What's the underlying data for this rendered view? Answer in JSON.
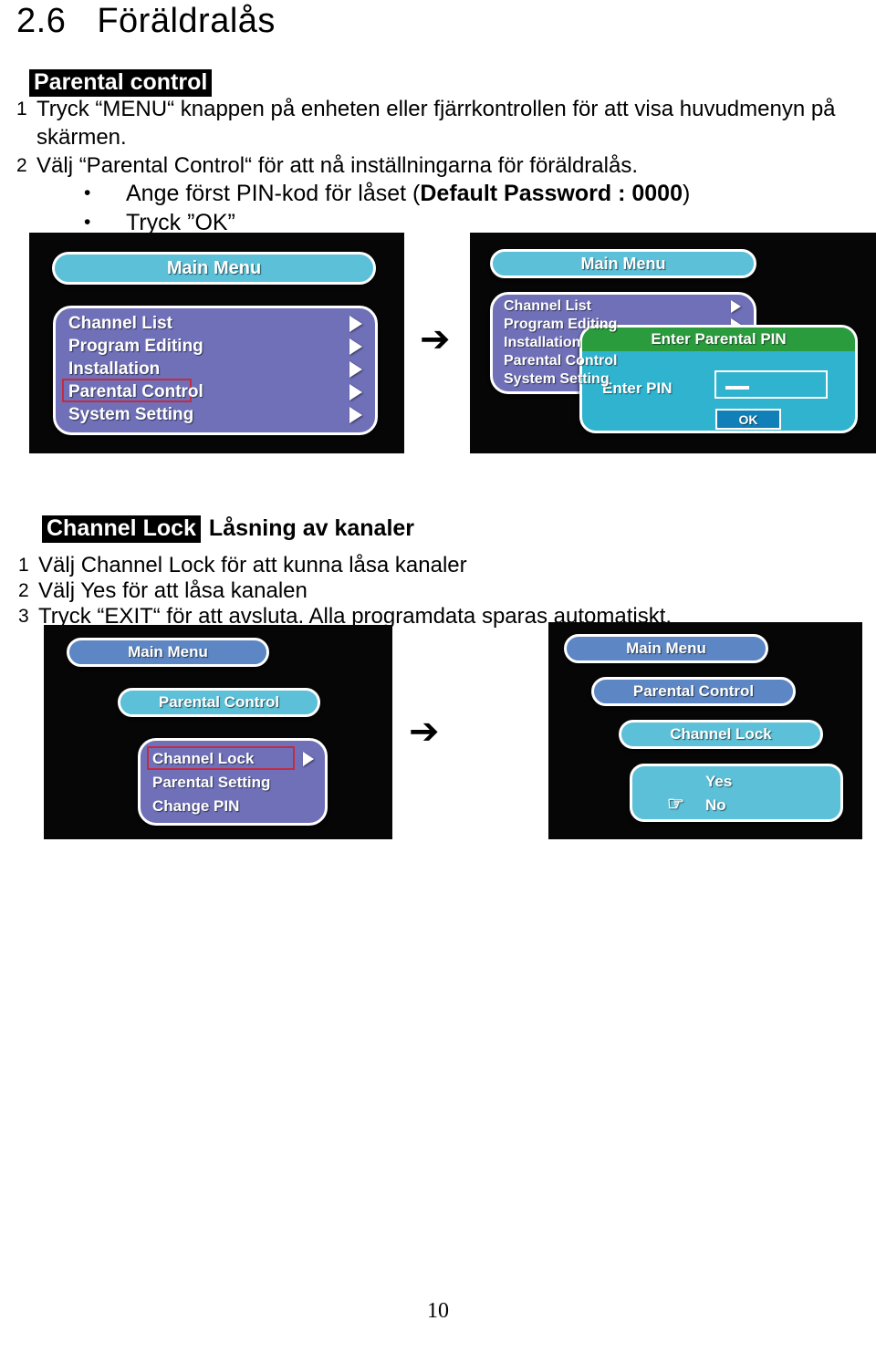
{
  "heading": {
    "number": "2.6",
    "title": "Föräldralås"
  },
  "section1": {
    "black_header": "Parental control",
    "steps": [
      {
        "index": "1",
        "text": "Tryck “MENU“ knappen på enheten eller fjärrkontrollen för att visa huvudmenyn på skärmen."
      },
      {
        "index": "2",
        "text": "Välj “Parental Control“ för att nå inställningarna för föräldralås."
      }
    ],
    "bullets": [
      {
        "marker": "•",
        "text_before": "Ange först PIN-kod för låset (",
        "text_bold": "Default Password : 0000",
        "text_after": ")"
      },
      {
        "marker": "•",
        "text_before": "Tryck ”OK”",
        "text_bold": "",
        "text_after": ""
      }
    ]
  },
  "section2": {
    "black_header": "Channel Lock",
    "header_suffix": "Låsning av kanaler",
    "steps": [
      {
        "index": "1",
        "text": "Välj Channel Lock för att kunna låsa kanaler"
      },
      {
        "index": "2",
        "text": "Välj Yes för att låsa kanalen"
      },
      {
        "index": "3",
        "text": "Tryck “EXIT“ för att avsluta. Alla programdata sparas automatiskt."
      }
    ]
  },
  "flow_arrow": "➔",
  "screens": {
    "top_left": {
      "title_bar": "Main Menu",
      "items": [
        {
          "label": "Channel List",
          "arrow": true,
          "selected": false
        },
        {
          "label": "Program Editing",
          "arrow": true,
          "selected": false
        },
        {
          "label": "Installation",
          "arrow": true,
          "selected": false
        },
        {
          "label": "Parental Control",
          "arrow": true,
          "selected": true
        },
        {
          "label": "System Setting",
          "arrow": true,
          "selected": false
        }
      ]
    },
    "top_right": {
      "title_bar": "Main Menu",
      "items": [
        {
          "label": "Channel List",
          "arrow": true
        },
        {
          "label": "Program Editing",
          "arrow": true
        },
        {
          "label": "Installation",
          "arrow": true
        },
        {
          "label": "Parental Control",
          "arrow": true
        },
        {
          "label": "System Setting",
          "arrow": true
        }
      ],
      "dialog": {
        "title": "Enter Parental PIN",
        "field_label": "Enter PIN",
        "field_value": "",
        "ok_label": "OK"
      }
    },
    "bottom_left": {
      "breadcrumb": [
        {
          "label": "Main Menu",
          "tone": "blue"
        },
        {
          "label": "Parental Control",
          "tone": "cyan"
        }
      ],
      "items": [
        {
          "label": "Channel Lock",
          "arrow": true,
          "selected": true
        },
        {
          "label": "Parental Setting",
          "arrow": false,
          "selected": false
        },
        {
          "label": "Change PIN",
          "arrow": false,
          "selected": false
        }
      ]
    },
    "bottom_right": {
      "breadcrumb": [
        {
          "label": "Main Menu",
          "tone": "blue"
        },
        {
          "label": "Parental Control",
          "tone": "blue"
        },
        {
          "label": "Channel Lock",
          "tone": "cyan"
        }
      ],
      "options": [
        {
          "label": "Yes",
          "pointer": false
        },
        {
          "label": "No",
          "pointer": true
        }
      ],
      "pointer_icon": "☞"
    }
  },
  "page_number": "10",
  "colors": {
    "osd_cyan": "#5bc0d8",
    "osd_blue": "#5c86c4",
    "osd_purple": "#6f70b8",
    "dialog_green": "#2a9c3d",
    "dialog_cyan": "#2fb3ce",
    "ok_blue": "#1280b8",
    "select_red": "#c32b40",
    "screen_black": "#060606"
  }
}
